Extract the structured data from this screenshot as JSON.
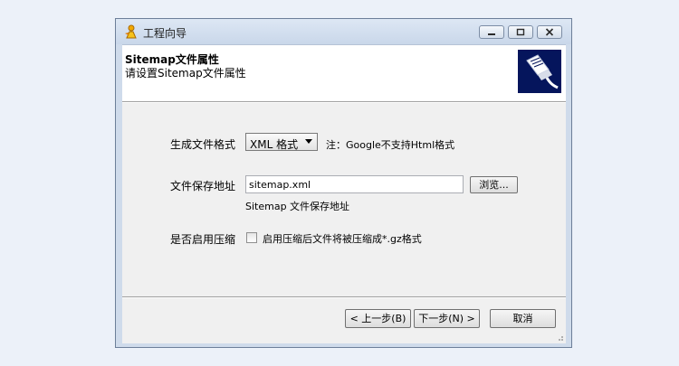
{
  "window": {
    "title": "工程向导"
  },
  "header": {
    "title": "Sitemap文件属性",
    "subtitle": "请设置Sitemap文件属性"
  },
  "form": {
    "format_label": "生成文件格式",
    "format_value": "XML 格式",
    "format_note": "注：Google不支持Html格式",
    "path_label": "文件保存地址",
    "path_value": "sitemap.xml",
    "browse_label": "浏览...",
    "path_hint": "Sitemap 文件保存地址",
    "compress_label": "是否启用压缩",
    "compress_checkbox_label": "启用压缩后文件将被压缩成*.gz格式",
    "compress_checked": false
  },
  "footer": {
    "prev_label": "< 上一步(B)",
    "next_label": "下一步(N) >",
    "cancel_label": "取消"
  },
  "icons": {
    "app": "wizard-app-icon",
    "header": "network-cable-icon",
    "minimize": "minimize-icon",
    "maximize": "maximize-icon",
    "close": "close-icon",
    "dropdown": "chevron-down-icon"
  },
  "colors": {
    "header_icon_bg": "#05155c",
    "window_frame": "#cfdbeb",
    "content_bg": "#f0f0f0"
  }
}
